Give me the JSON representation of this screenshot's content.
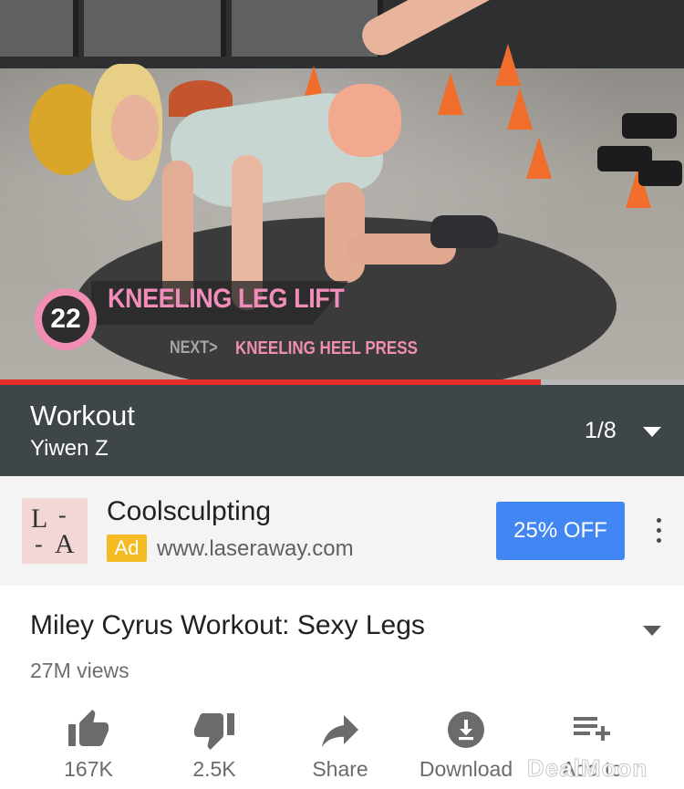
{
  "video": {
    "exercise_number": "22",
    "exercise_name": "KNEELING LEG LIFT",
    "next_label": "NEXT>",
    "next_exercise": "KNEELING HEEL PRESS",
    "progress_fraction": 0.79,
    "progress_color": "#e52d27"
  },
  "playlist": {
    "title": "Workout",
    "owner": "Yiwen Z",
    "position": "1/8"
  },
  "ad": {
    "logo_text": [
      "L",
      "-",
      "-",
      "A"
    ],
    "title": "Coolsculpting",
    "tag": "Ad",
    "url": "www.laseraway.com",
    "cta": "25% OFF",
    "cta_color": "#4286f4"
  },
  "info": {
    "title": "Miley Cyrus Workout: Sexy Legs",
    "views": "27M views"
  },
  "actions": [
    {
      "label": "167K",
      "icon": "thumbs-up-icon"
    },
    {
      "label": "2.5K",
      "icon": "thumbs-down-icon"
    },
    {
      "label": "Share",
      "icon": "share-icon"
    },
    {
      "label": "Download",
      "icon": "download-icon"
    },
    {
      "label": "Add to",
      "icon": "add-to-playlist-icon"
    }
  ],
  "watermark": "DealMoon"
}
